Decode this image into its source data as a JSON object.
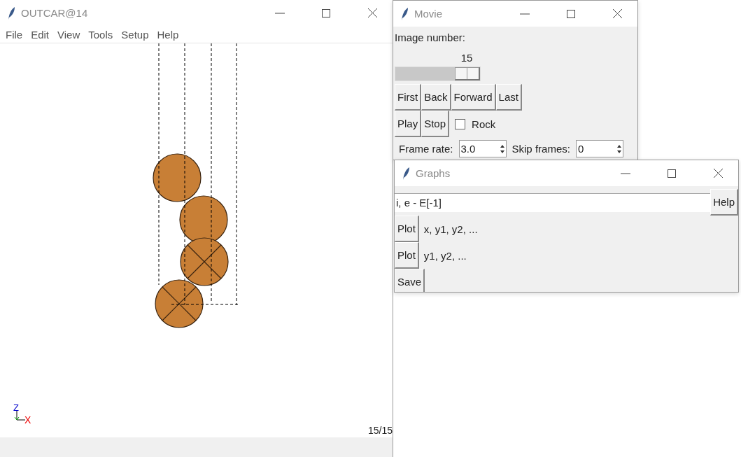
{
  "main_window": {
    "title": "OUTCAR@14",
    "menu": [
      "File",
      "Edit",
      "View",
      "Tools",
      "Setup",
      "Help"
    ],
    "atoms": [
      {
        "constrained": false
      },
      {
        "constrained": false
      },
      {
        "constrained": true
      },
      {
        "constrained": true
      }
    ],
    "axes": [
      "Z",
      "X"
    ],
    "frame_counter": "15/15"
  },
  "movie_window": {
    "title": "Movie",
    "image_number_label": "Image number:",
    "slider": {
      "value": "15",
      "level": 1.0
    },
    "nav_buttons": [
      "First",
      "Back",
      "Forward",
      "Last"
    ],
    "play_buttons": [
      "Play",
      "Stop"
    ],
    "rock": {
      "label": "Rock",
      "checked": false
    },
    "frame_rate": {
      "label": "Frame rate:",
      "value": "3.0"
    },
    "skip_frames": {
      "label": "Skip frames:",
      "value": "0"
    }
  },
  "graphs_window": {
    "title": "Graphs",
    "expression": "i, e - E[-1]",
    "help_button": "Help",
    "plots": [
      {
        "button": "Plot",
        "label": "x, y1, y2, ..."
      },
      {
        "button": "Plot",
        "label": "y1, y2, ..."
      }
    ],
    "save_button": "Save"
  }
}
